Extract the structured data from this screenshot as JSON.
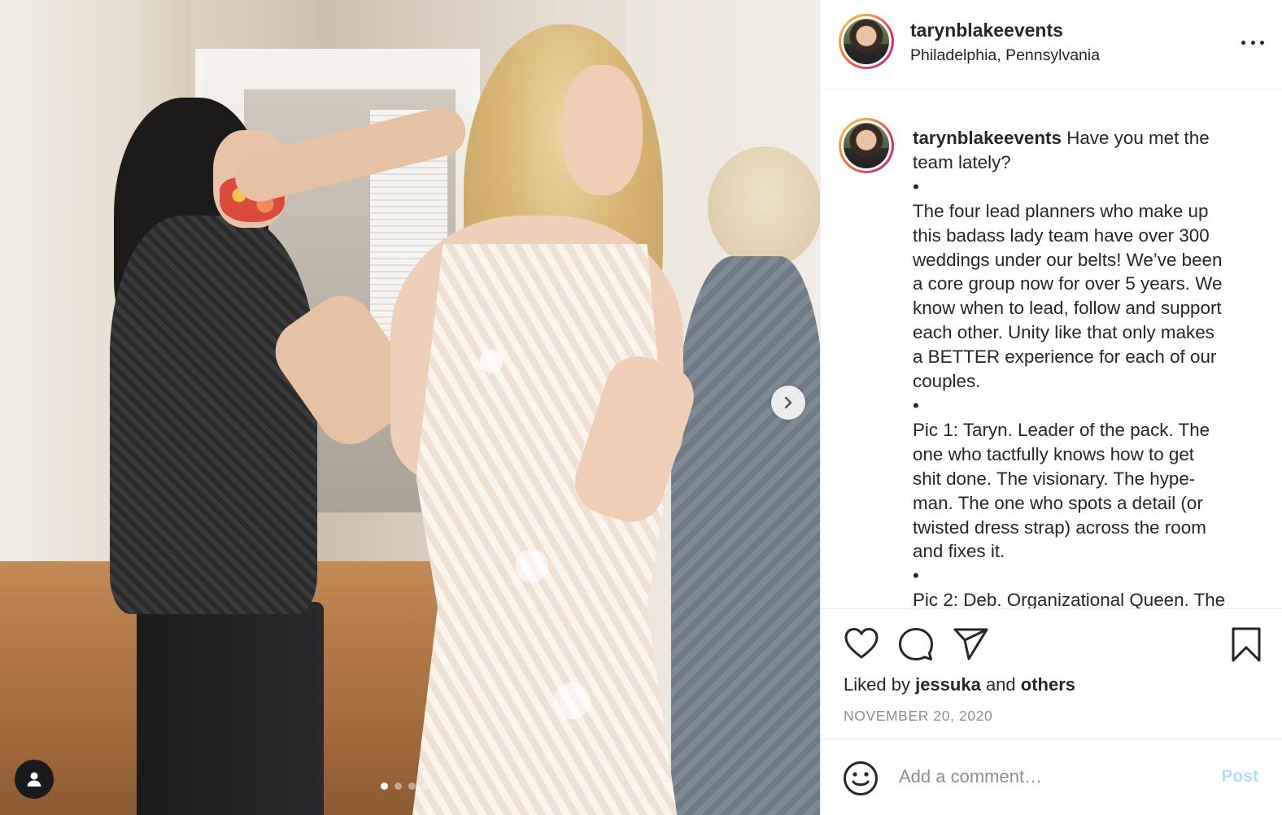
{
  "post": {
    "username": "tarynblakeevents",
    "location": "Philadelphia, Pennsylvania",
    "caption_lines": [
      "Have you met the",
      "team lately?",
      "•",
      "The four lead planners who make up",
      "this badass lady team have over 300",
      "weddings under our belts! We’ve been",
      "a core group now for over 5 years. We",
      "know when to lead, follow and support",
      "each other. Unity like that only makes",
      "a BETTER experience for each of our",
      "couples.",
      "•",
      "Pic 1: Taryn. Leader of the pack. The",
      "one who tactfully knows how to get",
      "shit done. The visionary. The hype-",
      "man. The one who spots a detail (or",
      "twisted dress strap) across the room",
      "and fixes it.",
      "•",
      "Pic 2: Deb. Organizational Queen. The"
    ],
    "liked_by_prefix": "Liked by",
    "liked_by_user": "jessuka",
    "liked_by_and": "and",
    "liked_by_others": "others",
    "date": "NOVEMBER 20, 2020"
  },
  "comment_box": {
    "placeholder": "Add a comment…",
    "post_label": "Post"
  },
  "carousel": {
    "total_images": 4,
    "current_index": 0
  },
  "icons": {
    "like": "heart-icon",
    "comment": "comment-icon",
    "share": "paper-plane-icon",
    "save": "bookmark-icon",
    "more": "more-options-icon",
    "emoji": "smiley-icon",
    "next": "chevron-right-icon",
    "tag": "user-tag-icon"
  },
  "colors": {
    "post_button": "#b2dffc",
    "secondary_text": "#8e8e8e",
    "primary_text": "#262626"
  }
}
